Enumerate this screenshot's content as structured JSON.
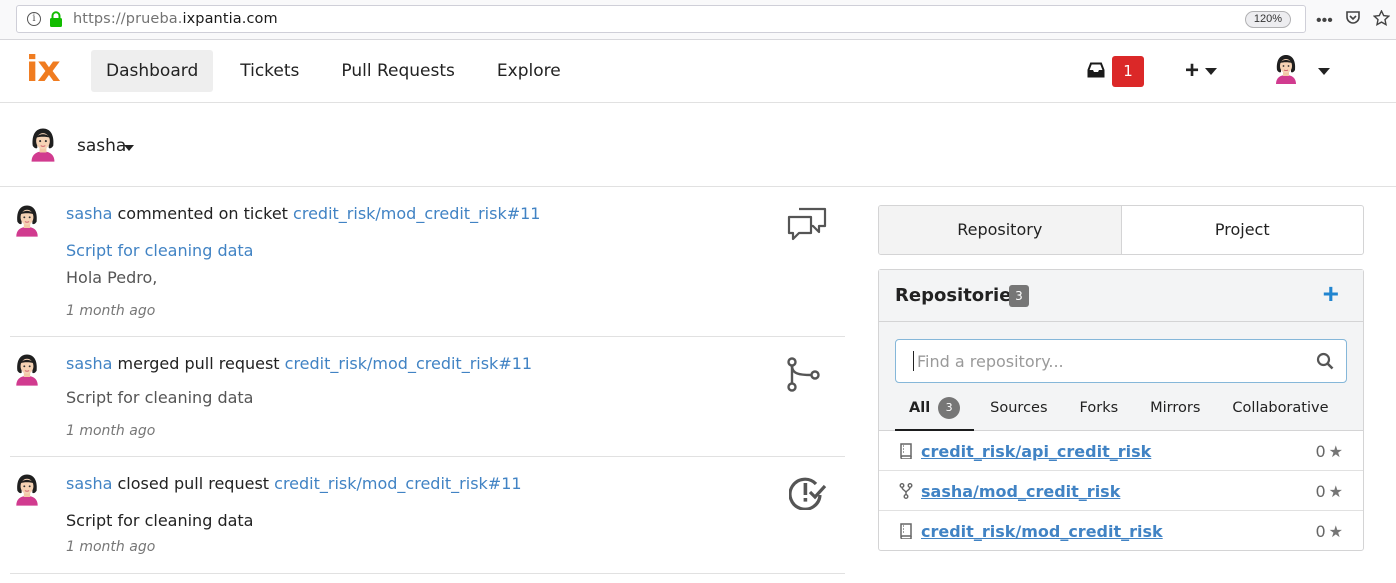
{
  "browser": {
    "url_prefix": "https://prueba.",
    "url_host": "ixpantia.com",
    "zoom": "120%",
    "more": "•••"
  },
  "navbar": {
    "logo": "ix",
    "links": [
      "Dashboard",
      "Tickets",
      "Pull Requests",
      "Explore"
    ],
    "active_link": "Dashboard",
    "inbox_count": "1",
    "plus": "+"
  },
  "user": {
    "name": "sasha"
  },
  "feed": [
    {
      "user": "sasha",
      "action": " commented on ticket ",
      "target": "credit_risk/mod_credit_risk#11",
      "title": "Script for cleaning data",
      "title_is_link": true,
      "body": "Hola Pedro,",
      "time": "1 month ago",
      "icon": "comments-icon"
    },
    {
      "user": "sasha",
      "action": " merged pull request ",
      "target": "credit_risk/mod_credit_risk#11",
      "title": "Script for cleaning data",
      "title_is_link": false,
      "time": "1 month ago",
      "icon": "merge-icon"
    },
    {
      "user": "sasha",
      "action": " closed pull request ",
      "target": "credit_risk/mod_credit_risk#11",
      "title": "Script for cleaning data",
      "title_is_link": false,
      "time": "1 month ago",
      "icon": "closed-pr-icon"
    }
  ],
  "sidepanel": {
    "tabs": [
      "Repository",
      "Project"
    ],
    "active_tab": "Repository",
    "repositories": {
      "heading": "Repositories",
      "count": "3",
      "search_placeholder": "Find a repository...",
      "filters": [
        "All",
        "Sources",
        "Forks",
        "Mirrors",
        "Collaborative"
      ],
      "active_filter": "All",
      "all_count": "3",
      "items": [
        {
          "name": "credit_risk/api_credit_risk",
          "stars": "0",
          "icon": "repo-icon"
        },
        {
          "name": "sasha/mod_credit_risk",
          "stars": "0",
          "icon": "fork-icon"
        },
        {
          "name": "credit_risk/mod_credit_risk",
          "stars": "0",
          "icon": "repo-icon"
        }
      ]
    }
  },
  "colors": {
    "accent_link": "#4183c4",
    "logo_orange": "#f07c20",
    "badge_red": "#db2828",
    "plus_blue": "#2185d0"
  }
}
